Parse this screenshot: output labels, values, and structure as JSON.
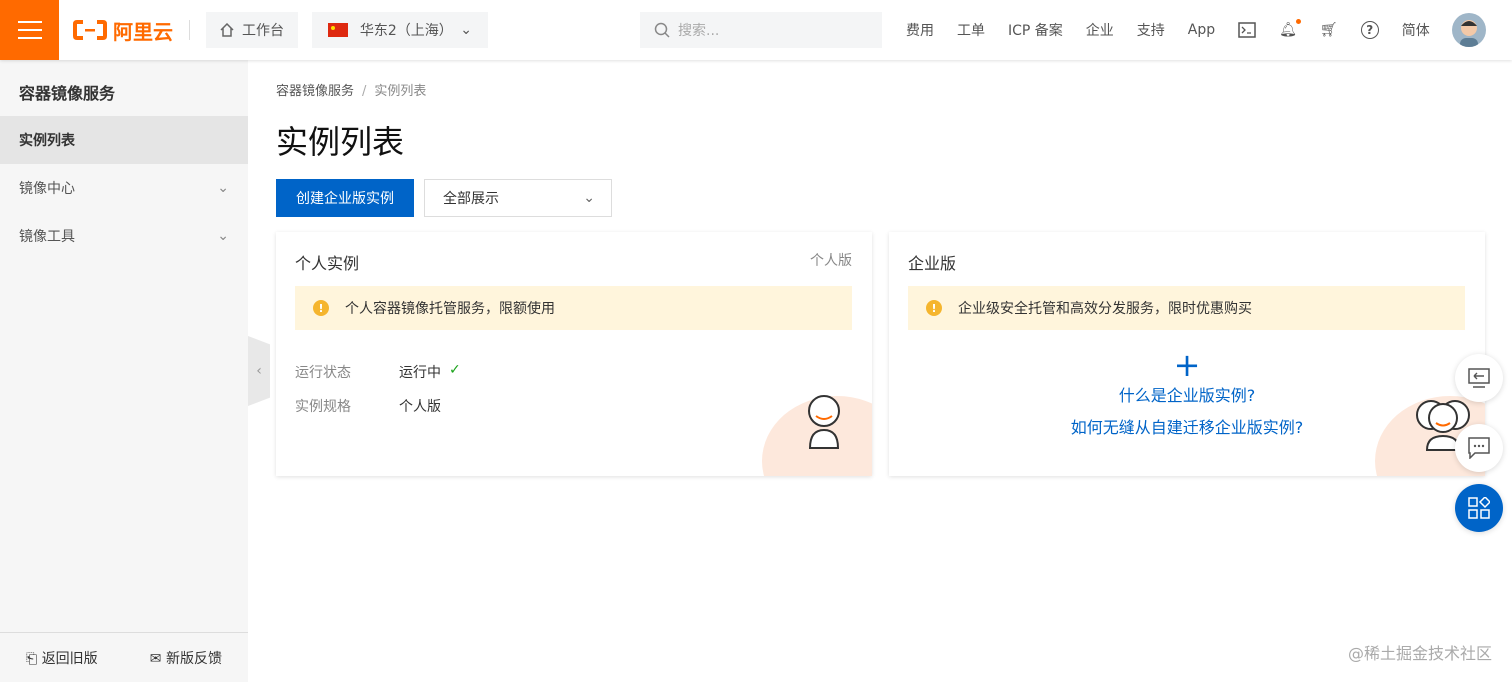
{
  "topbar": {
    "brand": "阿里云",
    "workbench": "工作台",
    "region": "华东2（上海）",
    "search_placeholder": "搜索...",
    "nav": [
      "费用",
      "工单",
      "ICP 备案",
      "企业",
      "支持",
      "App"
    ],
    "lang": "简体",
    "accent": "#ff6a00"
  },
  "sidebar": {
    "title": "容器镜像服务",
    "items": [
      {
        "label": "实例列表",
        "active": true
      },
      {
        "label": "镜像中心"
      },
      {
        "label": "镜像工具"
      }
    ],
    "footer": {
      "old": "返回旧版",
      "feedback": "新版反馈"
    }
  },
  "main": {
    "breadcrumb": [
      "容器镜像服务",
      "实例列表"
    ],
    "title": "实例列表",
    "create_button": "创建企业版实例",
    "filter": "全部展示",
    "personal": {
      "title": "个人实例",
      "tag": "个人版",
      "alert": "个人容器镜像托管服务，限额使用",
      "status_label": "运行状态",
      "status_value": "运行中",
      "spec_label": "实例规格",
      "spec_value": "个人版"
    },
    "enterprise": {
      "title": "企业版",
      "alert": "企业级安全托管和高效分发服务，限时优惠购买",
      "link1": "什么是企业版实例?",
      "link2": "如何无缝从自建迁移企业版实例?"
    }
  },
  "watermark": "@稀土掘金技术社区",
  "primary_color": "#0064c8"
}
